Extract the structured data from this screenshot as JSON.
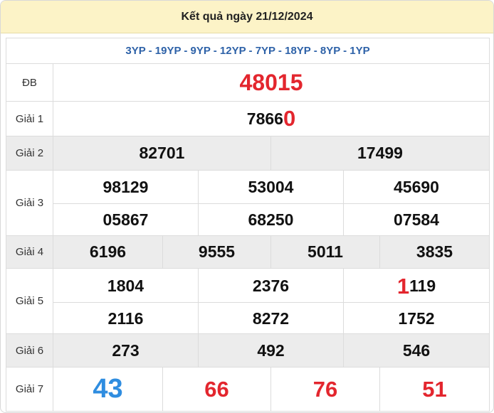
{
  "header": {
    "title": "Kết quả ngày 21/12/2024"
  },
  "codes": "3YP - 19YP - 9YP - 12YP - 7YP - 18YP - 8YP - 1YP",
  "prizes": {
    "db": {
      "label": "ĐB",
      "value": "48015",
      "color": "#e3262e"
    },
    "g1": {
      "label": "Giải 1",
      "main": "7866",
      "highlight": "0",
      "highlight_color": "#e3262e"
    },
    "g2": {
      "label": "Giải 2",
      "values": [
        "82701",
        "17499"
      ]
    },
    "g3": {
      "label": "Giải 3",
      "values": [
        "98129",
        "53004",
        "45690",
        "05867",
        "68250",
        "07584"
      ]
    },
    "g4": {
      "label": "Giải 4",
      "values": [
        "6196",
        "9555",
        "5011",
        "3835"
      ]
    },
    "g5": {
      "label": "Giải 5",
      "values": [
        "1804",
        "2376",
        "2116",
        "8272",
        "1752"
      ],
      "special": {
        "highlight": "1",
        "rest": "119",
        "highlight_color": "#e3262e"
      }
    },
    "g6": {
      "label": "Giải 6",
      "values": [
        "273",
        "492",
        "546"
      ]
    },
    "g7": {
      "label": "Giải 7",
      "values": [
        "43",
        "66",
        "76",
        "51"
      ],
      "colors": [
        "#2f8de0",
        "#e3262e",
        "#e3262e",
        "#e3262e"
      ]
    }
  }
}
